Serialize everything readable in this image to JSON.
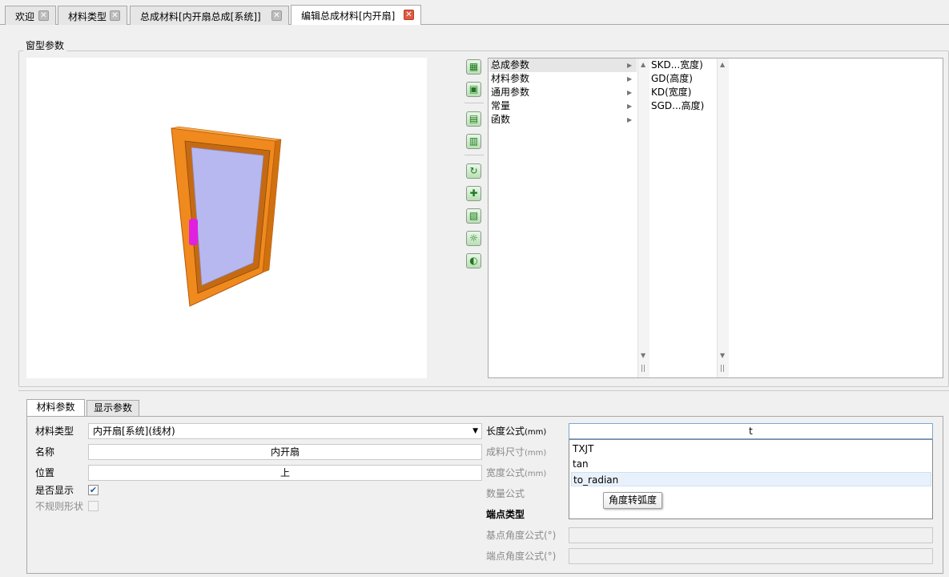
{
  "tabs": [
    {
      "label": "欢迎",
      "active": false
    },
    {
      "label": "材料类型",
      "active": false
    },
    {
      "label": "总成材料[内开扇总成[系统]]",
      "active": false
    },
    {
      "label": "编辑总成材料[内开扇]",
      "active": true
    }
  ],
  "window_params": {
    "legend": "窗型参数",
    "toolbar_icons": [
      "calculator-icon",
      "image-icon",
      "grid-icon",
      "grid-small-icon",
      "refresh-icon",
      "add-icon",
      "edit-grid-icon",
      "light-icon",
      "palette-icon"
    ],
    "categories": [
      {
        "label": "总成参数",
        "selected": true
      },
      {
        "label": "材料参数",
        "selected": false
      },
      {
        "label": "通用参数",
        "selected": false
      },
      {
        "label": "常量",
        "selected": false
      },
      {
        "label": "函数",
        "selected": false
      }
    ],
    "params": [
      "SKD...宽度)",
      "GD(高度)",
      "KD(宽度)",
      "SGD...高度)"
    ]
  },
  "bottom_tabs": [
    "材料参数",
    "显示参数"
  ],
  "form": {
    "material_type": {
      "label": "材料类型",
      "value": "内开扇[系统](线材)"
    },
    "name": {
      "label": "名称",
      "value": "内开扇"
    },
    "position": {
      "label": "位置",
      "value": "上"
    },
    "show": {
      "label": "是否显示",
      "checked": true
    },
    "irregular": {
      "label": "不规则形状",
      "checked": false
    },
    "length_formula": {
      "label": "长度公式",
      "unit": "(mm)",
      "value": "t"
    },
    "cut_size": {
      "label": "成料尺寸",
      "unit": "(mm)"
    },
    "width_formula": {
      "label": "宽度公式",
      "unit": "(mm)"
    },
    "qty_formula": {
      "label": "数量公式"
    },
    "end_type": {
      "label": "端点类型"
    },
    "base_angle": {
      "label": "基点角度公式(°)"
    },
    "end_angle": {
      "label": "端点角度公式(°)"
    }
  },
  "autocomplete": {
    "items": [
      "TXJT",
      "tan",
      "to_radian"
    ],
    "selected_index": 2,
    "tooltip": "角度转弧度"
  },
  "colors": {
    "frame": "#f08a1e",
    "glass": "#b8b8f0",
    "handle": "#e020e0"
  }
}
